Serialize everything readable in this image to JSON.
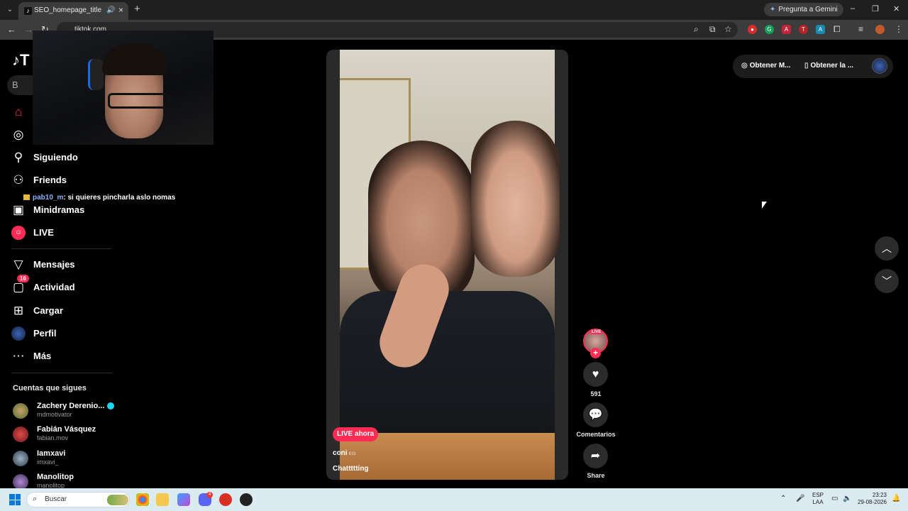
{
  "browser": {
    "tab_title": "SEO_homepage_title",
    "url": "tiktok.com",
    "gemini_label": "Pregunta a Gemini"
  },
  "sidebar": {
    "search_placeholder": "B",
    "items": [
      {
        "label": "",
        "icon": "home-icon"
      },
      {
        "label": "",
        "icon": "compass-icon"
      },
      {
        "label": "Siguiendo",
        "icon": "following-icon"
      },
      {
        "label": "Friends",
        "icon": "friends-icon"
      },
      {
        "label": "Minidramas",
        "icon": "film-icon"
      },
      {
        "label": "LIVE",
        "icon": "live-icon"
      },
      {
        "label": "Mensajes",
        "icon": "send-icon"
      },
      {
        "label": "Actividad",
        "icon": "activity-icon",
        "badge": "16"
      },
      {
        "label": "Cargar",
        "icon": "plus-square-icon"
      },
      {
        "label": "Perfil",
        "icon": "profile-icon"
      },
      {
        "label": "Más",
        "icon": "more-icon"
      }
    ],
    "following_title": "Cuentas que sigues",
    "accounts": [
      {
        "name": "Zachery Derenio...",
        "user": "mdmotivator",
        "verified": true
      },
      {
        "name": "Fabián Vásquez",
        "user": "fabian.mov"
      },
      {
        "name": "Iamxavi",
        "user": "imxavi_"
      },
      {
        "name": "Manolitop",
        "user": "manolitop"
      }
    ]
  },
  "chat": {
    "user": "pab10_m",
    "message": ": si quieres pincharla aslo nomas"
  },
  "video": {
    "live_label": "LIVE ahora",
    "username": "coni",
    "username_suffix": "ɛıɜ",
    "description": "Chattttting"
  },
  "actions": {
    "avatar_live": "LIVE",
    "likes": "591",
    "comments_label": "Comentarios",
    "share_label": "Share"
  },
  "topbar": {
    "get_coins": "Obtener M...",
    "get_app": "Obtener la ..."
  },
  "taskbar": {
    "search": "Buscar",
    "lang1": "ESP",
    "lang2": "LAA",
    "time": "23:23",
    "date": "29-08-2026",
    "discord_badge": "4"
  }
}
